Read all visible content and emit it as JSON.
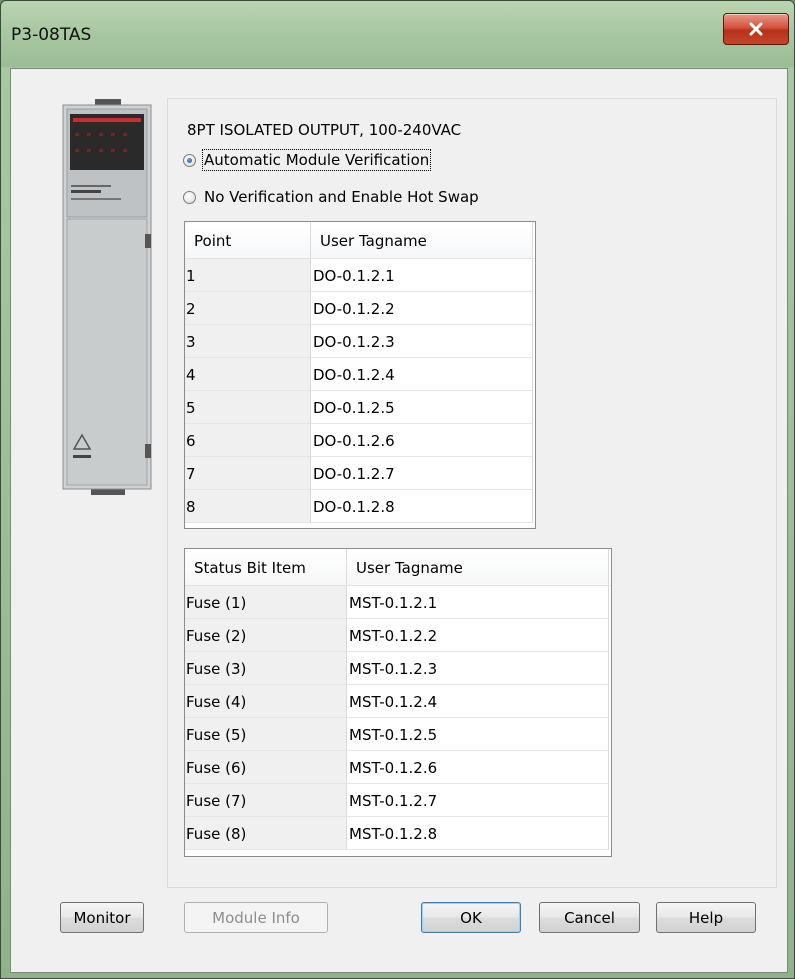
{
  "window": {
    "title": "P3-08TAS"
  },
  "module": {
    "description": "8PT ISOLATED OUTPUT, 100-240VAC",
    "verification_options": [
      {
        "label": "Automatic Module Verification",
        "checked": true
      },
      {
        "label": "No Verification and Enable Hot Swap",
        "checked": false
      }
    ]
  },
  "points_table": {
    "headers": [
      "Point",
      "User Tagname"
    ],
    "rows": [
      [
        "1",
        "DO-0.1.2.1"
      ],
      [
        "2",
        "DO-0.1.2.2"
      ],
      [
        "3",
        "DO-0.1.2.3"
      ],
      [
        "4",
        "DO-0.1.2.4"
      ],
      [
        "5",
        "DO-0.1.2.5"
      ],
      [
        "6",
        "DO-0.1.2.6"
      ],
      [
        "7",
        "DO-0.1.2.7"
      ],
      [
        "8",
        "DO-0.1.2.8"
      ]
    ]
  },
  "status_table": {
    "headers": [
      "Status Bit Item",
      "User Tagname"
    ],
    "rows": [
      [
        "Fuse (1)",
        "MST-0.1.2.1"
      ],
      [
        "Fuse (2)",
        "MST-0.1.2.2"
      ],
      [
        "Fuse (3)",
        "MST-0.1.2.3"
      ],
      [
        "Fuse (4)",
        "MST-0.1.2.4"
      ],
      [
        "Fuse (5)",
        "MST-0.1.2.5"
      ],
      [
        "Fuse (6)",
        "MST-0.1.2.6"
      ],
      [
        "Fuse (7)",
        "MST-0.1.2.7"
      ],
      [
        "Fuse (8)",
        "MST-0.1.2.8"
      ]
    ]
  },
  "buttons": {
    "monitor": "Monitor",
    "module_info": "Module Info",
    "ok": "OK",
    "cancel": "Cancel",
    "help": "Help"
  },
  "icons": {
    "close": "close-icon",
    "module_image": "module-image"
  },
  "colors": {
    "close_button": "#c8452c",
    "title_bar": "#a7c7a0",
    "default_button_border": "#3c7fb1"
  }
}
